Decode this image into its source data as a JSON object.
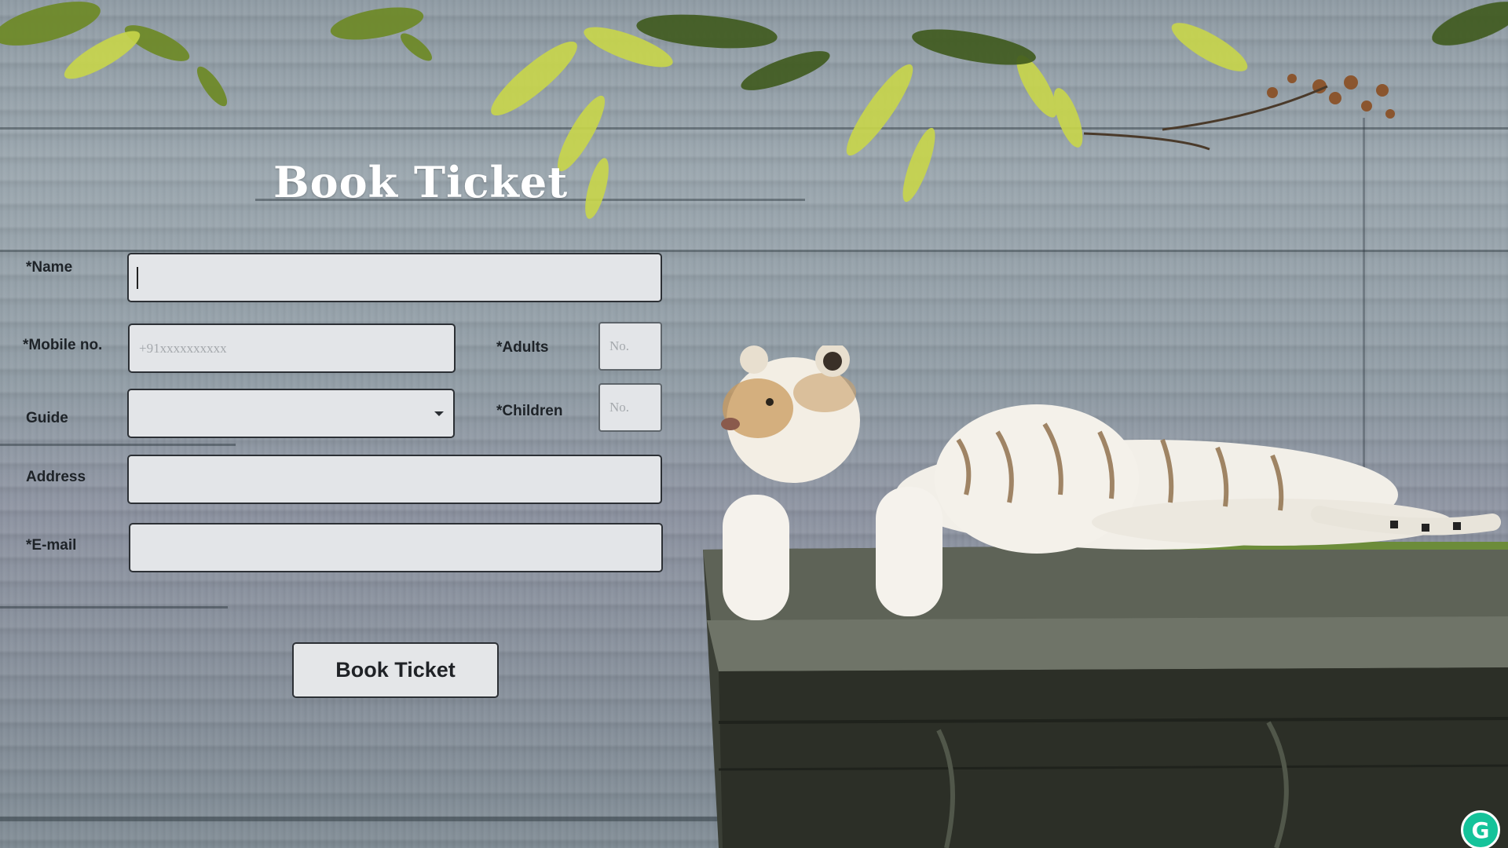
{
  "form": {
    "title": "Book Ticket",
    "name_label": "*Name",
    "name_value": "",
    "mobile_label": "*Mobile no.",
    "mobile_placeholder": "+91xxxxxxxxxx",
    "adults_label": "*Adults",
    "adults_placeholder": "No.",
    "guide_label": "Guide",
    "guide_selected": "",
    "children_label": "*Children",
    "children_placeholder": "No.",
    "address_label": "Address",
    "email_label": "*E-mail",
    "submit_label": "Book Ticket"
  },
  "extension": {
    "icon": "grammarly-icon",
    "glyph": "G",
    "color": "#15c39a"
  },
  "background": {
    "scene": "white tiger lying on a stone ledge in front of a concrete wall, tree branches overhead"
  }
}
